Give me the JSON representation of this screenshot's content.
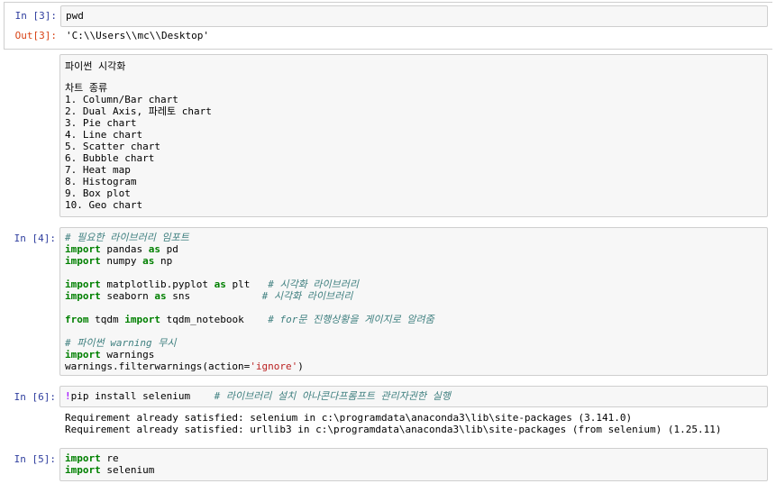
{
  "cell1": {
    "in_prompt": "In [3]:",
    "code": "pwd",
    "out_prompt": "Out[3]:",
    "output": "'C:\\\\Users\\\\mc\\\\Desktop'"
  },
  "markdown": {
    "title": "파이썬 시각화",
    "subtitle": "차트 종류",
    "items": [
      "1. Column/Bar chart",
      "2. Dual Axis, 파레토 chart",
      "3. Pie chart",
      "4. Line chart",
      "5. Scatter chart",
      "6. Bubble chart",
      "7. Heat map",
      "8. Histogram",
      "9. Box plot",
      "10. Geo chart"
    ]
  },
  "cell2": {
    "in_prompt": "In [4]:",
    "comment1": "# 필요한 라이브러리 임포트",
    "l2_kw1": "import",
    "l2_mod": " pandas ",
    "l2_kw2": "as",
    "l2_alias": " pd",
    "l3_kw1": "import",
    "l3_mod": " numpy ",
    "l3_kw2": "as",
    "l3_alias": " np",
    "l5_kw1": "import",
    "l5_mod": " matplotlib.pyplot ",
    "l5_kw2": "as",
    "l5_alias": " plt   ",
    "l5_cm": "# 시각화 라이브러리",
    "l6_kw1": "import",
    "l6_mod": " seaborn ",
    "l6_kw2": "as",
    "l6_alias": " sns            ",
    "l6_cm": "# 시각화 라이브러리",
    "l8_kw1": "from",
    "l8_mod": " tqdm ",
    "l8_kw2": "import",
    "l8_alias": " tqdm_notebook    ",
    "l8_cm": "# for문 진행상황을 게이지로 알려줌",
    "comment2": "# 파이썬 warning 무시",
    "l11_kw": "import",
    "l11_mod": " warnings",
    "l12_pre": "warnings.filterwarnings(action=",
    "l12_str": "'ignore'",
    "l12_post": ")"
  },
  "cell3": {
    "in_prompt": "In [6]:",
    "bang": "!",
    "cmd": "pip install selenium    ",
    "comment": "# 라이브러리 설치 아나콘다프롬프트 관리자권한 실행",
    "output": [
      "Requirement already satisfied: selenium in c:\\programdata\\anaconda3\\lib\\site-packages (3.141.0)",
      "Requirement already satisfied: urllib3 in c:\\programdata\\anaconda3\\lib\\site-packages (from selenium) (1.25.11)"
    ]
  },
  "cell4": {
    "in_prompt": "In [5]:",
    "l1_kw": "import",
    "l1_mod": " re",
    "l2_kw": "import",
    "l2_mod": " selenium"
  }
}
